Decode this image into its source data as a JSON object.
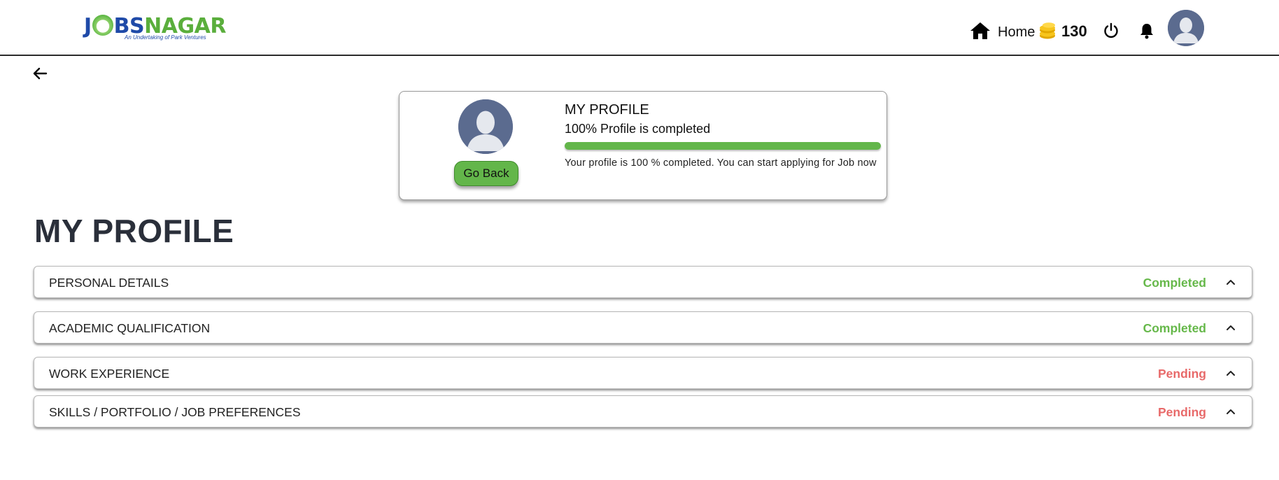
{
  "header": {
    "logo": {
      "part1": "J",
      "part2": "BS",
      "part3": "NAGAR",
      "tagline": "An Undertaking of Park Ventures"
    },
    "home_label": "Home",
    "coins": "130",
    "icons": [
      "home-icon",
      "coin-icon",
      "power-icon",
      "bell-icon",
      "avatar"
    ]
  },
  "profile_card": {
    "title": "MY PROFILE",
    "status": "100% Profile is completed",
    "progress": 1.0,
    "message": "Your profile is 100 % completed. You can start applying for Job now",
    "go_back_label": "Go Back"
  },
  "main": {
    "title": "MY PROFILE",
    "sections": [
      {
        "label": "PERSONAL DETAILS",
        "status": "Completed"
      },
      {
        "label": "ACADEMIC QUALIFICATION",
        "status": "Completed"
      },
      {
        "label": "WORK EXPERIENCE",
        "status": "Pending"
      },
      {
        "label": "SKILLS / PORTFOLIO / JOB PREFERENCES",
        "status": "Pending"
      }
    ]
  },
  "colors": {
    "completed": "#66b84a",
    "pending": "#e86a6a",
    "accent_green": "#63b64a",
    "brand_blue": "#1f4aa8"
  }
}
